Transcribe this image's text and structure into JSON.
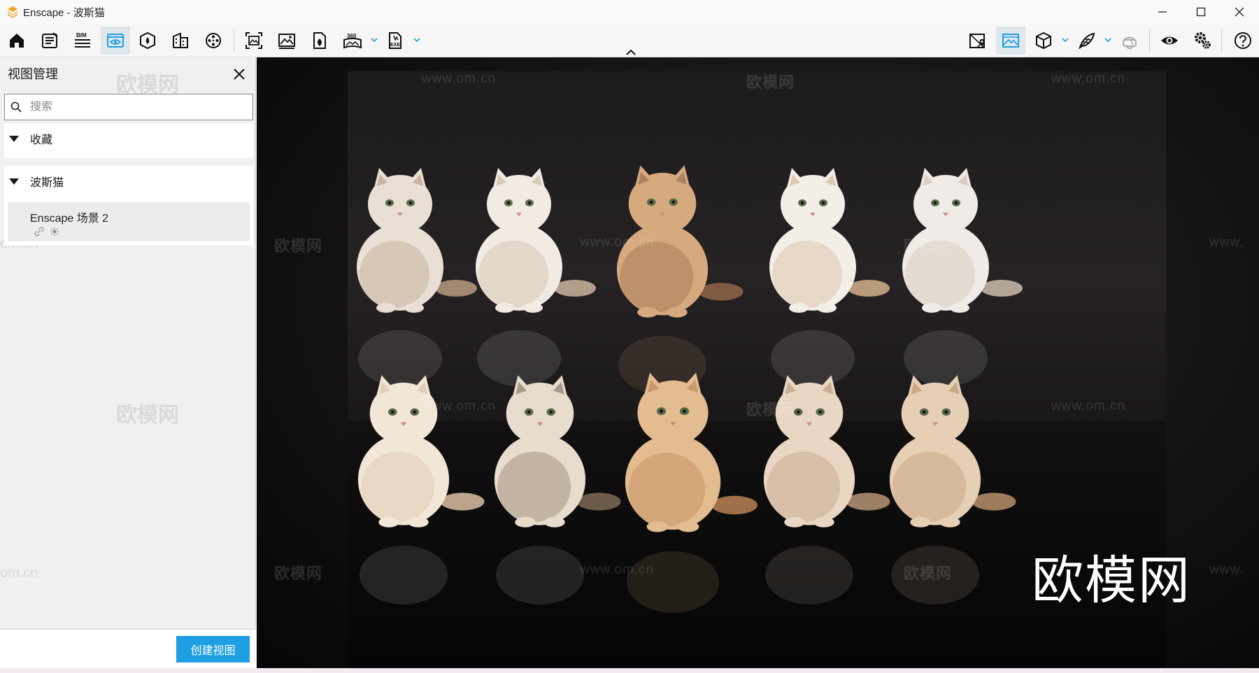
{
  "window": {
    "title": "Enscape - 波斯猫",
    "logo_color": "#f5a623",
    "controls": [
      "minimize-icon",
      "maximize-icon",
      "close-icon"
    ]
  },
  "toolbar": {
    "left_buttons": [
      {
        "name": "home",
        "icon": "home-icon",
        "label": ""
      },
      {
        "name": "notes",
        "icon": "notes-icon",
        "label": ""
      },
      {
        "name": "bim",
        "icon": "bim-icon",
        "label": "BIM"
      },
      {
        "name": "view-management",
        "icon": "eye-window-icon",
        "label": "",
        "active": true
      },
      {
        "name": "assets",
        "icon": "asset-library-icon",
        "label": ""
      },
      {
        "name": "material-editor",
        "icon": "building-icon",
        "label": ""
      },
      {
        "name": "video-editor",
        "icon": "film-reel-icon",
        "label": ""
      },
      {
        "name": "batch-render",
        "icon": "batch-render-icon",
        "label": ""
      },
      {
        "name": "screenshot",
        "icon": "image-icon",
        "label": ""
      },
      {
        "name": "web-standalone",
        "icon": "upload-file-icon",
        "label": ""
      },
      {
        "name": "panorama",
        "icon": "panorama-icon",
        "label": "360"
      },
      {
        "name": "exe-export",
        "icon": "exe-file-icon",
        "label": "EXE"
      }
    ],
    "right_buttons": [
      {
        "name": "map",
        "icon": "map-pin-icon"
      },
      {
        "name": "visual-settings",
        "icon": "landscape-icon",
        "active": true
      },
      {
        "name": "orthographic",
        "icon": "cube-icon"
      },
      {
        "name": "capture",
        "icon": "feather-icon"
      },
      {
        "name": "vr-headset",
        "icon": "vr-headset-icon"
      },
      {
        "name": "view-mode",
        "icon": "eye-icon"
      },
      {
        "name": "settings",
        "icon": "gears-icon"
      },
      {
        "name": "help",
        "icon": "help-icon"
      }
    ],
    "accent": "#1e9fe3"
  },
  "panel": {
    "title": "视图管理",
    "search_placeholder": "搜索",
    "groups": [
      {
        "label": "收藏",
        "items": []
      },
      {
        "label": "波斯猫",
        "items": [
          {
            "name": "Enscape 场景 2"
          }
        ]
      }
    ],
    "create_button": "创建视图",
    "create_button_color": "#1e9fe3"
  },
  "viewport": {
    "watermark_text": "欧模网",
    "watermark_url": "www.om.cn",
    "partial_url_left": "om.cn",
    "partial_url_right": "www.",
    "big_watermark": "欧模网"
  }
}
